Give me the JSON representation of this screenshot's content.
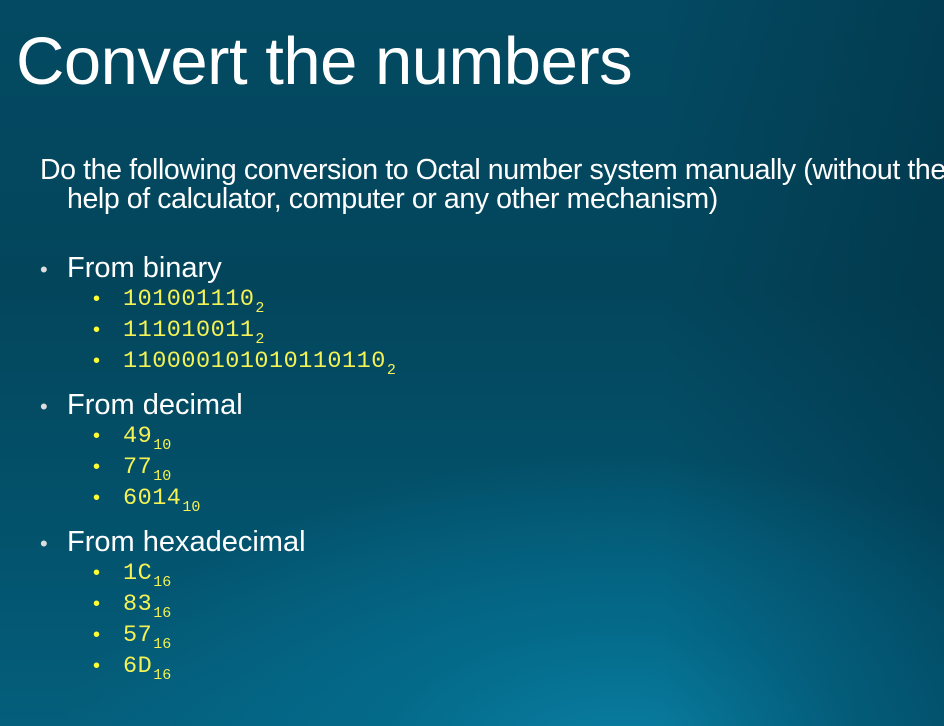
{
  "slide": {
    "title": "Convert the numbers",
    "intro": "Do the following conversion to Octal number system manually (without the help of calculator, computer or any other mechanism)",
    "bullet_glyph": "•",
    "colors": {
      "title_text": "#ffffff",
      "number_text": "#f4f255",
      "background_top": "#034a62",
      "background_bottom": "#0a7fa3"
    },
    "groups": [
      {
        "label": "From binary",
        "items": [
          {
            "value": "101001110",
            "base": "2"
          },
          {
            "value": "111010011",
            "base": "2"
          },
          {
            "value": "110000101010110110",
            "base": "2"
          }
        ]
      },
      {
        "label": "From decimal",
        "items": [
          {
            "value": "49",
            "base": "10"
          },
          {
            "value": "77",
            "base": "10"
          },
          {
            "value": "6014",
            "base": "10"
          }
        ]
      },
      {
        "label": "From hexadecimal",
        "items": [
          {
            "value": "1C",
            "base": "16"
          },
          {
            "value": "83",
            "base": "16"
          },
          {
            "value": "57",
            "base": "16"
          },
          {
            "value": "6D",
            "base": "16"
          }
        ]
      }
    ]
  }
}
